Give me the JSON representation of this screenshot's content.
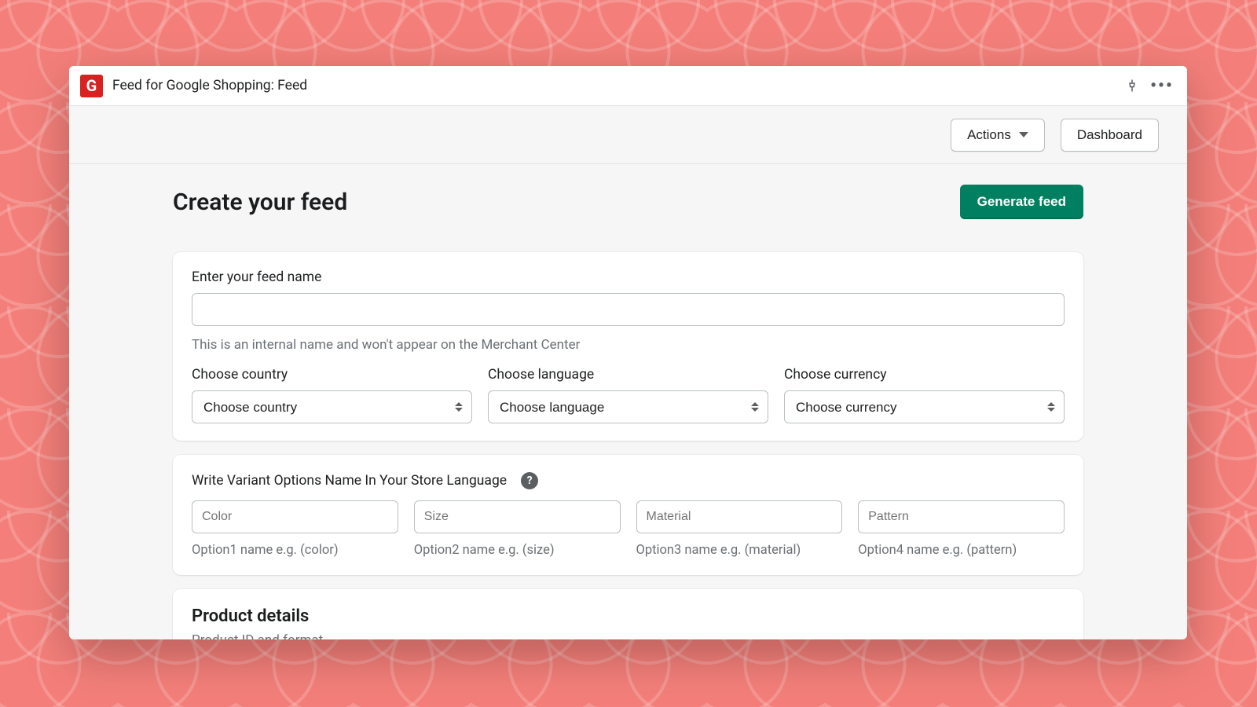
{
  "header": {
    "logo_letter": "G",
    "app_title": "Feed for Google Shopping: Feed"
  },
  "action_bar": {
    "actions_label": "Actions",
    "dashboard_label": "Dashboard"
  },
  "page": {
    "title": "Create your feed",
    "generate_label": "Generate feed"
  },
  "feed_name": {
    "label": "Enter your feed name",
    "value": "",
    "help": "This is an internal name and won't appear on the Merchant Center"
  },
  "selects": {
    "country_label": "Choose country",
    "country_selected": "Choose country",
    "language_label": "Choose language",
    "language_selected": "Choose language",
    "currency_label": "Choose currency",
    "currency_selected": "Choose currency"
  },
  "variants": {
    "heading": "Write Variant Options Name In Your Store Language",
    "option1_placeholder": "Color",
    "option1_hint": "Option1 name e.g. (color)",
    "option2_placeholder": "Size",
    "option2_hint": "Option2 name e.g. (size)",
    "option3_placeholder": "Material",
    "option3_hint": "Option3 name e.g. (material)",
    "option4_placeholder": "Pattern",
    "option4_hint": "Option4 name e.g. (pattern)"
  },
  "product_details": {
    "title": "Product details",
    "sub": "Product ID and format"
  }
}
